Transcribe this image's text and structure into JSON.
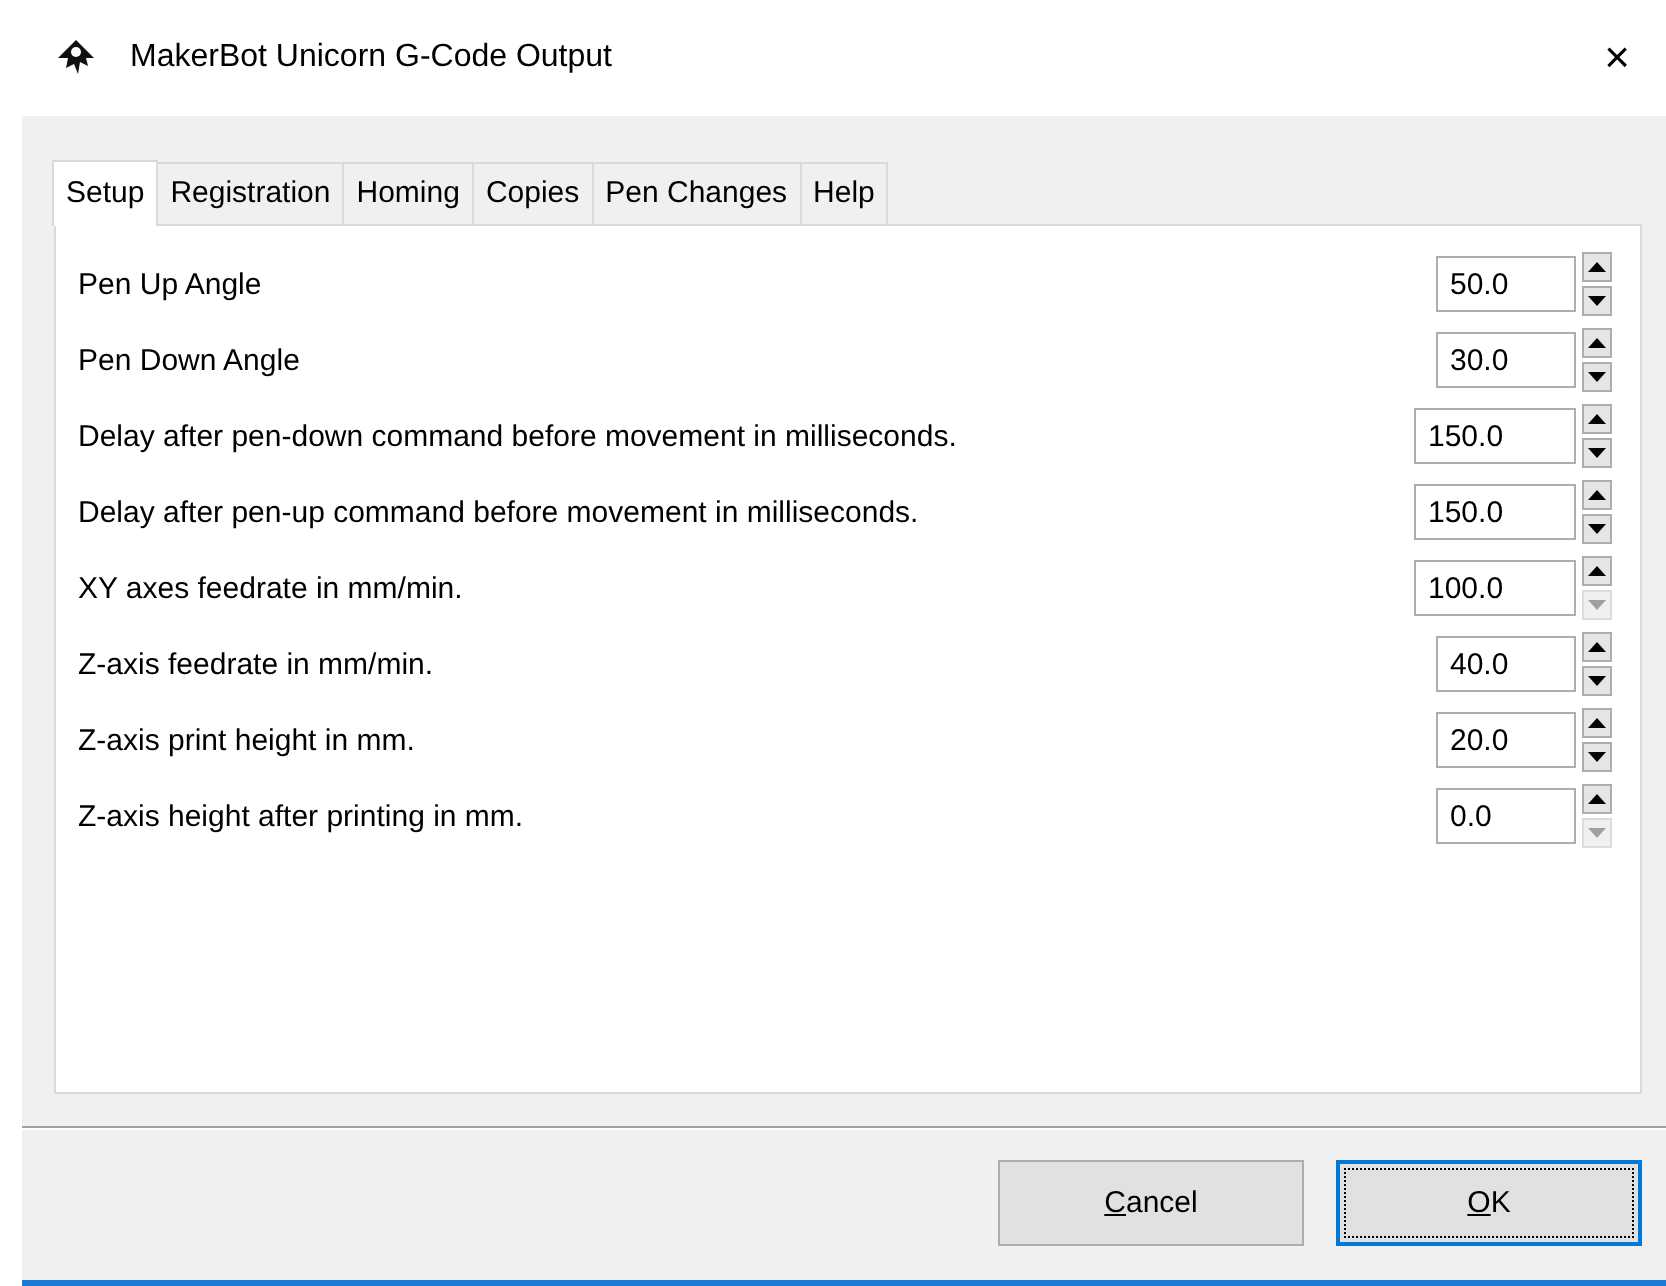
{
  "window": {
    "title": "MakerBot Unicorn G-Code Output",
    "close": "×"
  },
  "tabs": [
    {
      "label": "Setup",
      "selected": true
    },
    {
      "label": "Registration",
      "selected": false
    },
    {
      "label": "Homing",
      "selected": false
    },
    {
      "label": "Copies",
      "selected": false
    },
    {
      "label": "Pen Changes",
      "selected": false
    },
    {
      "label": "Help",
      "selected": false
    }
  ],
  "settings": [
    {
      "label": "Pen Up Angle",
      "value": "50.0",
      "down_disabled": false
    },
    {
      "label": "Pen Down Angle",
      "value": "30.0",
      "down_disabled": false
    },
    {
      "label": "Delay after pen-down command before movement in milliseconds.",
      "value": "150.0",
      "down_disabled": false
    },
    {
      "label": "Delay after pen-up command before movement in milliseconds.",
      "value": "150.0",
      "down_disabled": false
    },
    {
      "label": "XY axes feedrate in mm/min.",
      "value": "100.0",
      "down_disabled": true
    },
    {
      "label": "Z-axis feedrate in mm/min.",
      "value": "40.0",
      "down_disabled": false
    },
    {
      "label": "Z-axis print height in mm.",
      "value": "20.0",
      "down_disabled": false
    },
    {
      "label": "Z-axis height after printing in mm.",
      "value": "0.0",
      "down_disabled": true
    }
  ],
  "buttons": [
    {
      "label": "Cancel",
      "focused": false,
      "underline_first": true
    },
    {
      "label": "OK",
      "focused": true,
      "underline_first": true
    }
  ]
}
